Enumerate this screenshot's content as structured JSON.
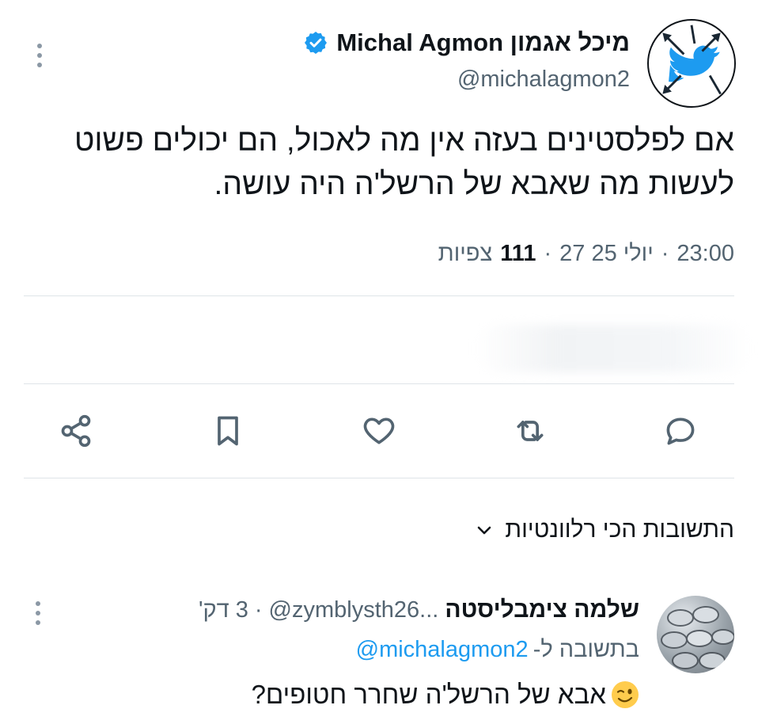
{
  "tweet": {
    "display_name": "Michal Agmon מיכל אגמון",
    "handle": "@michalagmon2",
    "text": "אם לפלסטינים בעזה אין מה לאכול, הם יכולים פשוט לעשות מה שאבא של הרשל'ה היה עושה.",
    "time": "23:00",
    "date": "27 יולי 25",
    "views_count": "111",
    "views_label": "צפיות",
    "separator": "·",
    "verified": true
  },
  "actions": [
    {
      "name": "reply",
      "icon": "reply-icon"
    },
    {
      "name": "retweet",
      "icon": "retweet-icon"
    },
    {
      "name": "like",
      "icon": "heart-icon"
    },
    {
      "name": "bookmark",
      "icon": "bookmark-icon"
    },
    {
      "name": "share",
      "icon": "share-icon"
    }
  ],
  "replies_section": {
    "sort_label": "התשובות הכי רלוונטיות"
  },
  "reply": {
    "name": "שלמה צימבליסטה",
    "handle": "@zymblysth26...",
    "separator": "·",
    "time": "3 דק'",
    "reply_to_label": "בתשובה ל-",
    "reply_to_handle": "@michalagmon2",
    "text": "אבא של הרשל'ה שחרר חטופים?",
    "emoji": "winking-face"
  },
  "colors": {
    "accent": "#1d9bf0",
    "text": "#0f1419",
    "secondary": "#536471",
    "divider": "#dfe4e8"
  }
}
